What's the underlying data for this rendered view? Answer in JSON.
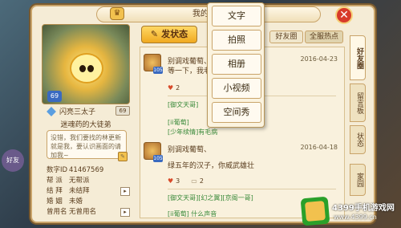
{
  "title": "我的空间",
  "close_label": "✕",
  "profile": {
    "level": "69",
    "name": "闪亮三太子",
    "mini_badge": "69",
    "title_line": "迷魂药的大徒弟",
    "signature": "没错，我们要找的林更新就是我，要认识画面的请加我~",
    "info": [
      {
        "k": "数字ID",
        "v": "41467569"
      },
      {
        "k": "帮  派",
        "v": "无帮派"
      },
      {
        "k": "结  拜",
        "v": "未结拜"
      },
      {
        "k": "婚  姻",
        "v": "未婚"
      },
      {
        "k": "曾用名",
        "v": "无曾用名"
      }
    ]
  },
  "post_button": "发状态",
  "filter_tabs": [
    "好友圈",
    "全服热点"
  ],
  "menu": [
    "文字",
    "拍照",
    "相册",
    "小视频",
    "空间秀"
  ],
  "feed": [
    {
      "level": "105",
      "line1": "别调戏葡萄、",
      "date": "2016-04-23",
      "line2": "等一下，我老",
      "likes": "2",
      "comment1": "[御文天哥]",
      "comment2": "[ii葡萄]",
      "comment3": "[少年续情]有毛病"
    },
    {
      "level": "105",
      "line1": "别调戏葡萄、",
      "date": "2016-04-18",
      "line2": "绿五年的汉子，你威武雄壮",
      "likes": "3",
      "comments": "2",
      "comment1": "[御文天哥][幻之翼][京阁一哥]",
      "comment2": "[ii葡萄] 什么声音"
    }
  ],
  "side_tabs": [
    "好友圈",
    "留言板",
    "状态",
    "家园"
  ],
  "corner_label": "好友",
  "watermark": {
    "brand": "游戏大全",
    "line1": "4399手机游戏网",
    "line2": "www.4399.cn"
  }
}
